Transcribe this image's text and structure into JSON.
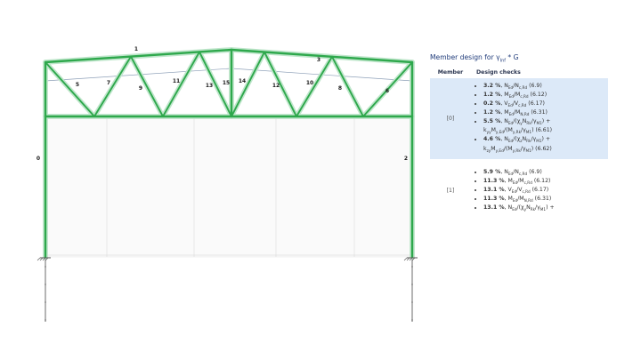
{
  "structure": {
    "member_labels": [
      "0",
      "1",
      "2",
      "3",
      "5",
      "7",
      "9",
      "11",
      "13",
      "15",
      "14",
      "12",
      "10",
      "8",
      "6"
    ],
    "colors": {
      "member": "#2ea84c",
      "member_light": "#bfe6cb",
      "model": "#8ea0b8",
      "column_base": "#555555"
    }
  },
  "results": {
    "title": "Member design for γ",
    "title_sub": "Inf",
    "title_suffix": " * G",
    "col_member": "Member",
    "col_checks": "Design checks",
    "rows": [
      {
        "member": "[0]",
        "checks": [
          {
            "pct": "3.2 %",
            "formula": "N<sub>Ed</sub>/N<sub>c,Rd</sub> (6.9)"
          },
          {
            "pct": "1.2 %",
            "formula": "M<sub>Ed</sub>/M<sub>c,Rd</sub> (6.12)"
          },
          {
            "pct": "0.2 %",
            "formula": "V<sub>Ed</sub>/V<sub>c,Rd</sub> (6.17)"
          },
          {
            "pct": "1.2 %",
            "formula": "M<sub>Ed</sub>/M<sub>N,Rd</sub> (6.31)"
          },
          {
            "pct": "5.5 %",
            "formula": "N<sub>Ed</sub>/(χ<sub>y</sub>N<sub>Rk</sub>/γ<sub>M1</sub>) +<br>k<sub>yy</sub>M<sub>y,Ed</sub>/(M<sub>y,Rk</sub>/γ<sub>M1</sub>) (6.61)"
          },
          {
            "pct": "4.6 %",
            "formula": "N<sub>Ed</sub>/(χ<sub>z</sub>N<sub>Rk</sub>/γ<sub>M1</sub>) +<br>k<sub>zy</sub>M<sub>y,Ed</sub>/(M<sub>y,Rk</sub>/γ<sub>M1</sub>) (6.62)"
          }
        ]
      },
      {
        "member": "[1]",
        "checks": [
          {
            "pct": "5.9 %",
            "formula": "N<sub>Ed</sub>/N<sub>c,Rd</sub> (6.9)"
          },
          {
            "pct": "11.3 %",
            "formula": "M<sub>Ed</sub>/M<sub>c,Rd</sub> (6.12)"
          },
          {
            "pct": "13.1 %",
            "formula": "V<sub>Ed</sub>/V<sub>c,Rd</sub> (6.17)"
          },
          {
            "pct": "11.3 %",
            "formula": "M<sub>Ed</sub>/M<sub>N,Rd</sub> (6.31)"
          },
          {
            "pct": "13.1 %",
            "formula": "N<sub>Ed</sub>/(χ<sub>y</sub>N<sub>Rk</sub>/γ<sub>M1</sub>) +"
          }
        ]
      }
    ]
  }
}
